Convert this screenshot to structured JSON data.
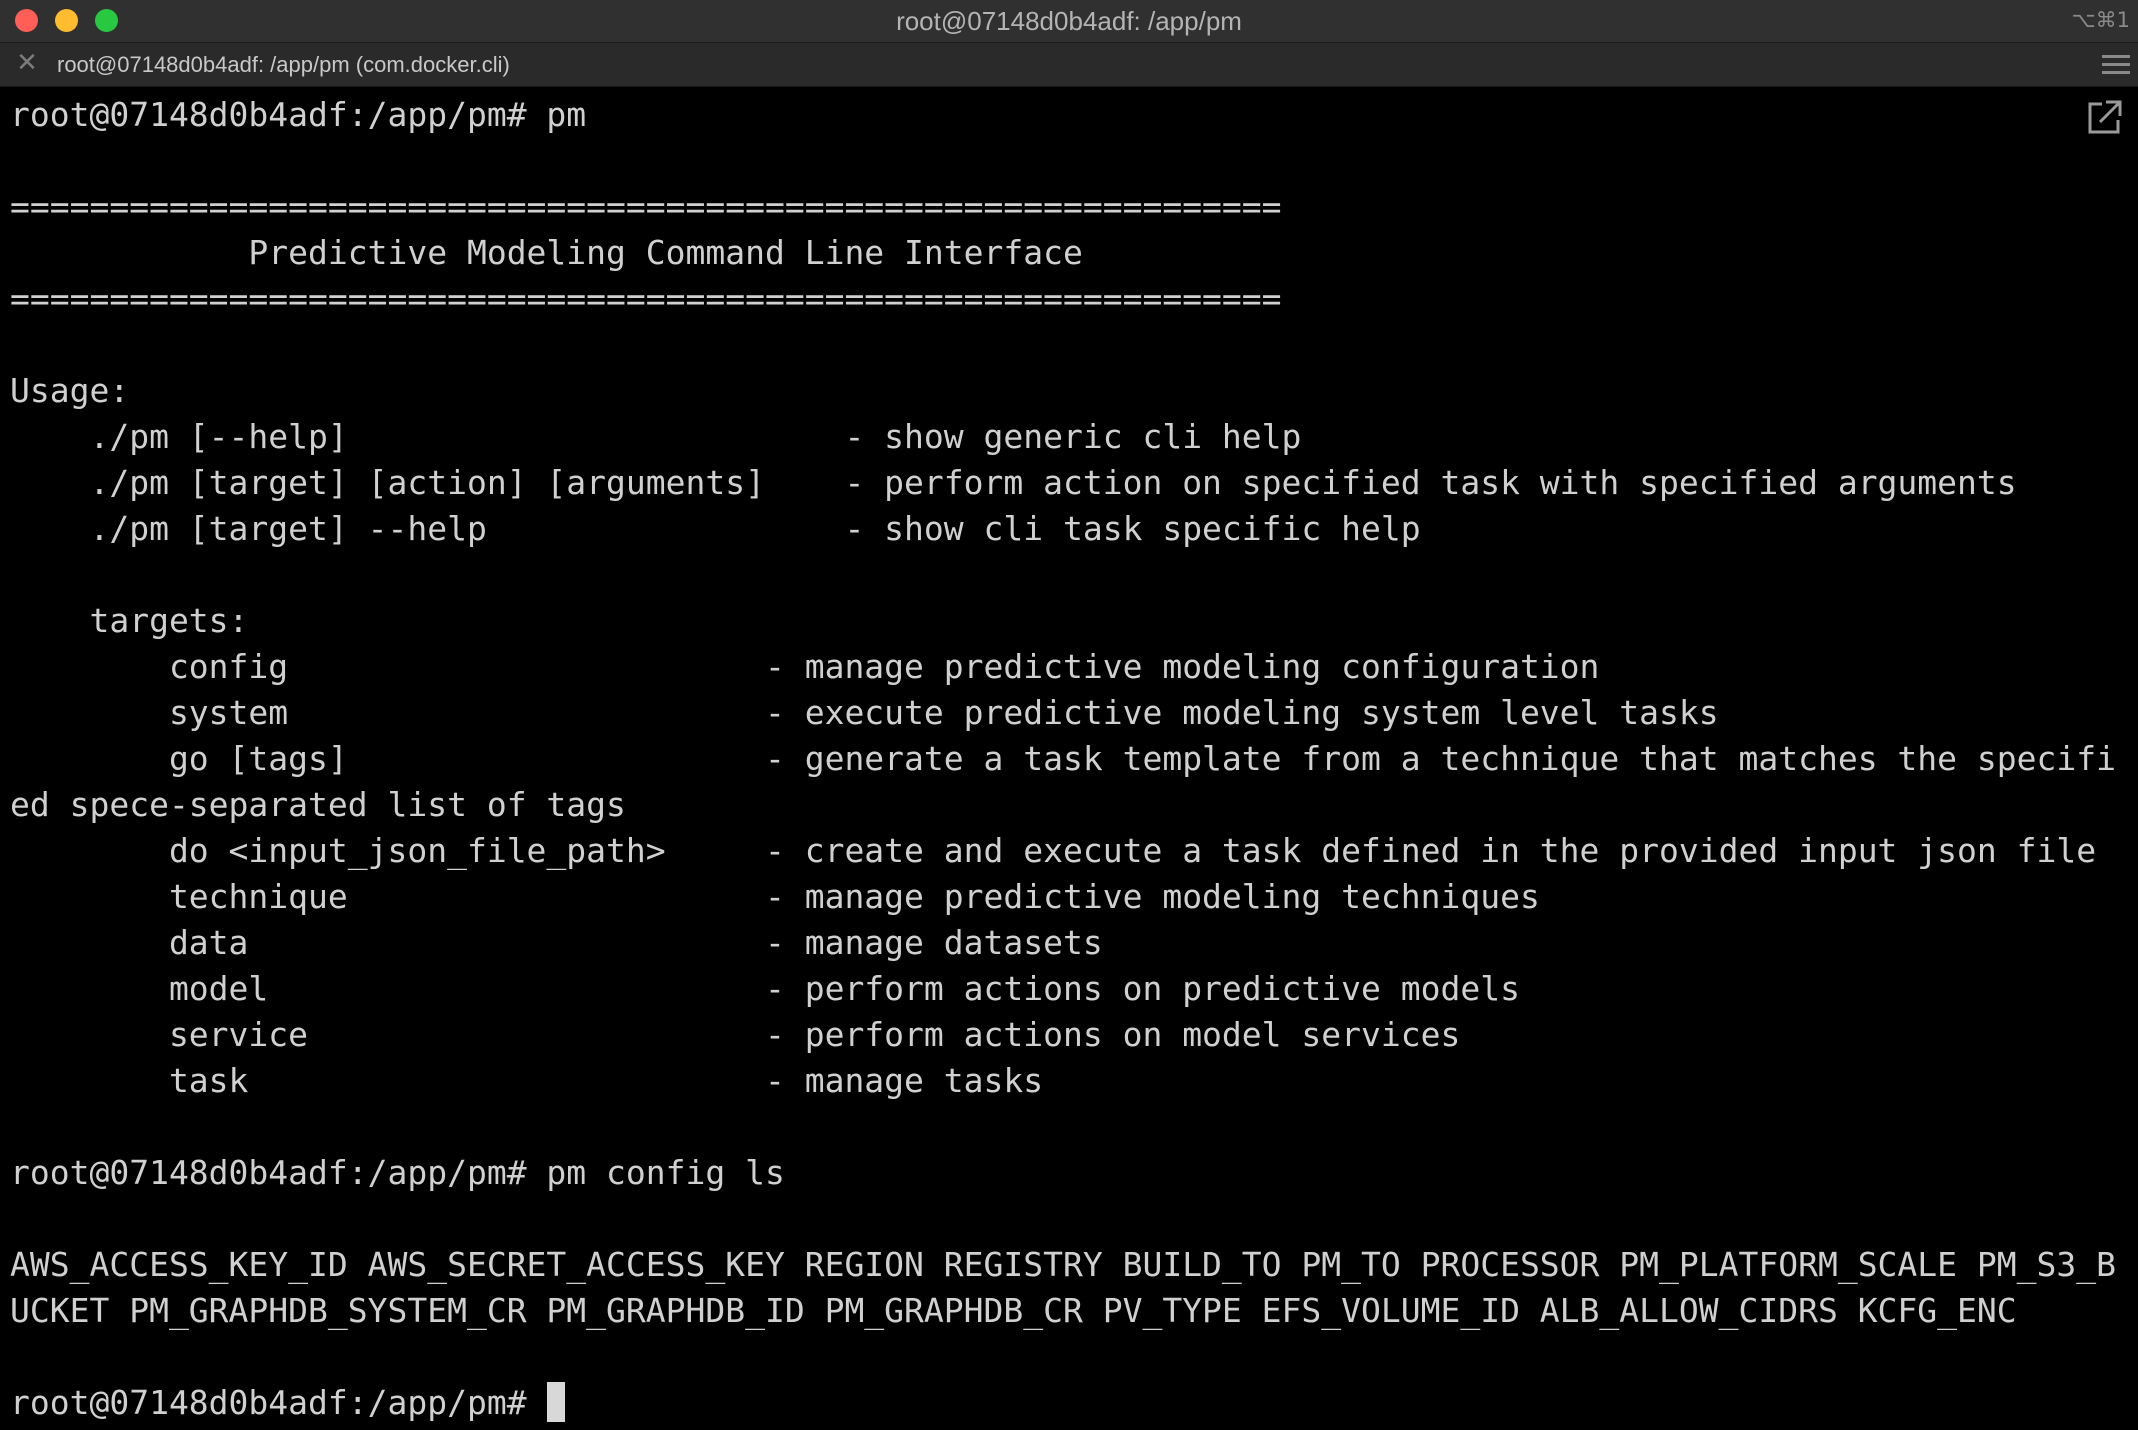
{
  "window": {
    "title": "root@07148d0b4adf: /app/pm",
    "shortcut": "⌥⌘1"
  },
  "tab": {
    "title": "root@07148d0b4adf: /app/pm (com.docker.cli)"
  },
  "icons": {
    "tab_close": "close-icon",
    "tab_menu": "hamburger-menu-icon",
    "popout": "pop-out-window-icon"
  },
  "terminal": {
    "lines": [
      "root@07148d0b4adf:/app/pm# pm",
      "",
      "================================================================",
      "            Predictive Modeling Command Line Interface",
      "================================================================",
      "",
      "Usage:",
      "    ./pm [--help]                         - show generic cli help",
      "    ./pm [target] [action] [arguments]    - perform action on specified task with specified arguments",
      "    ./pm [target] --help                  - show cli task specific help",
      "",
      "    targets:",
      "        config                        - manage predictive modeling configuration",
      "        system                        - execute predictive modeling system level tasks",
      "        go [tags]                     - generate a task template from a technique that matches the specifi",
      "ed spece-separated list of tags",
      "        do <input_json_file_path>     - create and execute a task defined in the provided input json file",
      "        technique                     - manage predictive modeling techniques",
      "        data                          - manage datasets",
      "        model                         - perform actions on predictive models",
      "        service                       - perform actions on model services",
      "        task                          - manage tasks",
      "",
      "root@07148d0b4adf:/app/pm# pm config ls",
      "",
      "AWS_ACCESS_KEY_ID AWS_SECRET_ACCESS_KEY REGION REGISTRY BUILD_TO PM_TO PROCESSOR PM_PLATFORM_SCALE PM_S3_B",
      "UCKET PM_GRAPHDB_SYSTEM_CR PM_GRAPHDB_ID PM_GRAPHDB_CR PV_TYPE EFS_VOLUME_ID ALB_ALLOW_CIDRS KCFG_ENC",
      ""
    ],
    "prompt": "root@07148d0b4adf:/app/pm#"
  }
}
